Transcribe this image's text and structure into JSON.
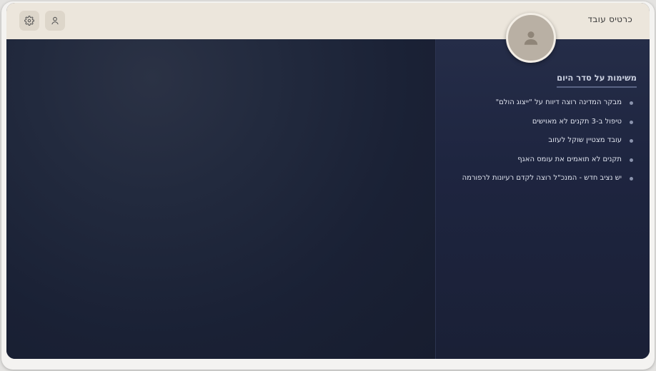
{
  "header": {
    "title": "כרטיס עובד",
    "settings_icon": "gear-icon",
    "user_icon": "user-icon"
  },
  "profile": {
    "avatar_icon": "person-icon"
  },
  "agenda": {
    "title": "משימות על סדר היום",
    "items": [
      "מבקר המדינה רוצה דיווח על \"ייצוג הולם\"",
      "טיפול ב-3 תקנים לא מאוישים",
      "עובד מצטיין שוקל לעזוב",
      "תקנים לא תואמים את עומס האגף",
      "יש נציב חדש - המנכ\"ל רוצה לקדם רעיונות לרפורמה"
    ]
  },
  "colors": {
    "header_bg": "#ece6dc",
    "panel_bg": "#1b2338",
    "accent_underline": "#5a6484"
  }
}
